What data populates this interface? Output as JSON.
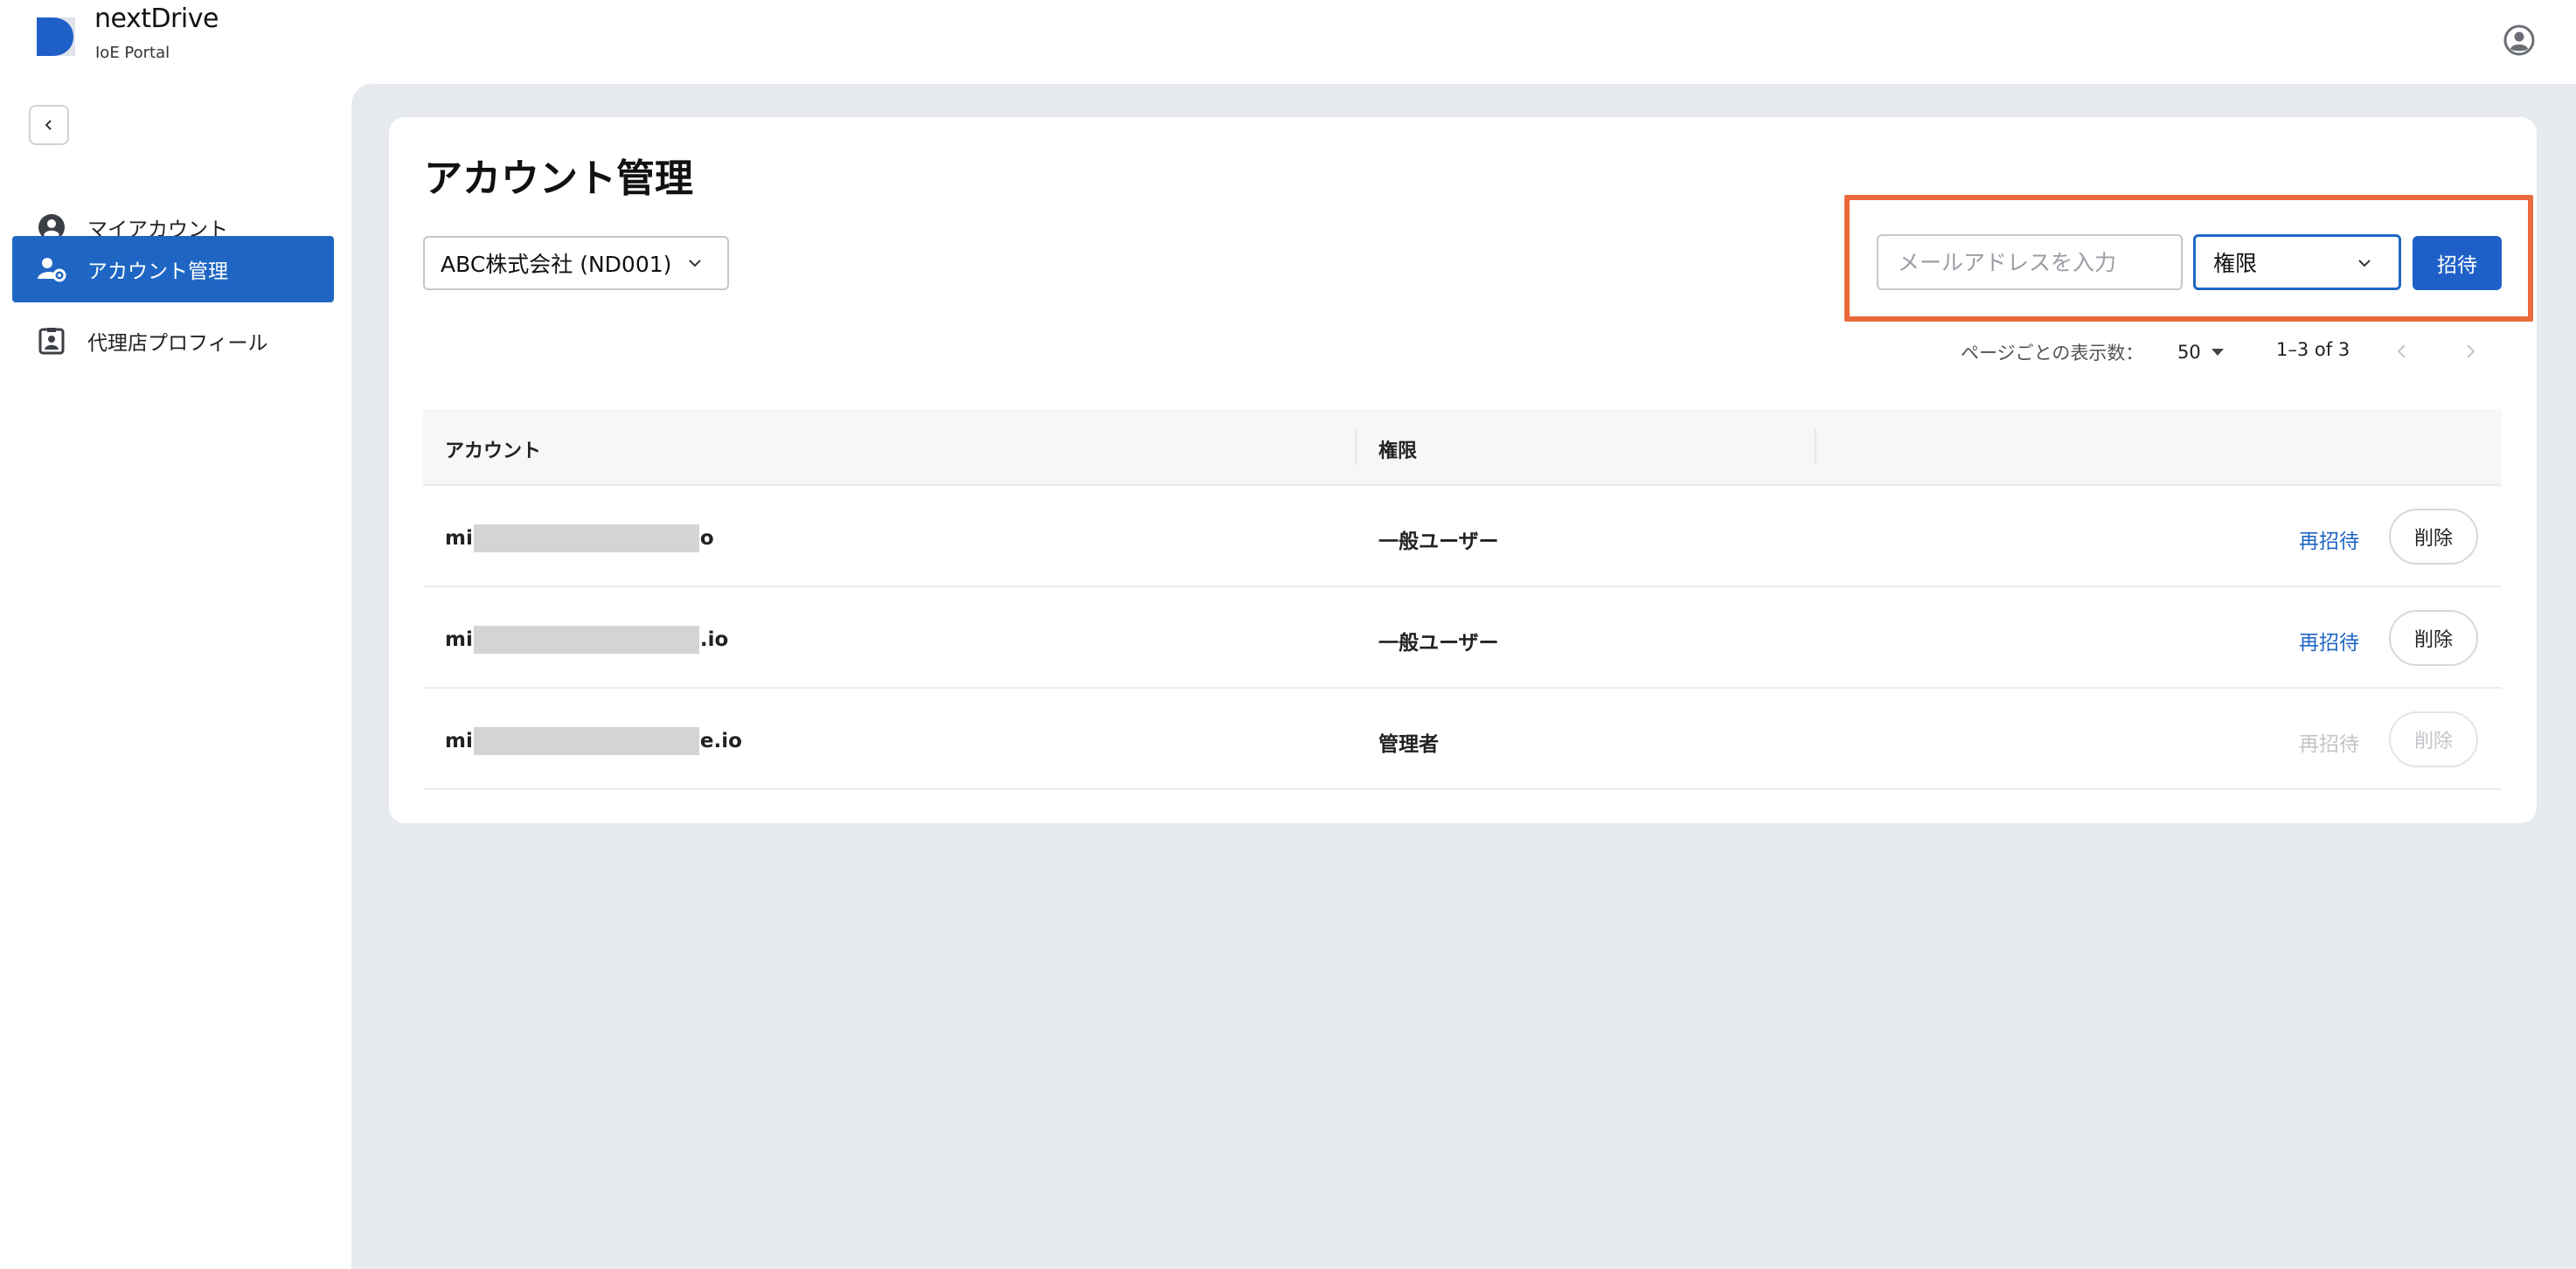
{
  "brand": {
    "name": "nextDrive",
    "subtitle": "IoE Portal",
    "logo_icon": "nextdrive-logo-icon",
    "color": "#1f5fc8"
  },
  "header": {
    "account_icon": "account-circle-icon"
  },
  "sidebar": {
    "collapse_icon": "chevron-left-icon",
    "items": [
      {
        "label": "マイアカウント",
        "icon": "account-circle-icon",
        "active": false
      },
      {
        "label": "アカウント管理",
        "icon": "user-gear-icon",
        "active": true
      },
      {
        "label": "代理店プロフィール",
        "icon": "id-badge-icon",
        "active": false
      }
    ],
    "active_color": "#1f66c4"
  },
  "main": {
    "title": "アカウント管理",
    "company_select": {
      "value": "ABC株式会社 (ND001)"
    },
    "invite": {
      "email_placeholder": "メールアドレスを入力",
      "role_value": "権限",
      "button_label": "招待",
      "highlight_color": "#ea6a3c"
    },
    "pagination": {
      "label": "ページごとの表示数：",
      "page_size": "50",
      "range": "1–3 of 3"
    },
    "table": {
      "headers": {
        "account": "アカウント",
        "role": "権限"
      },
      "rows": [
        {
          "account_prefix": "mi",
          "account_suffix": "o",
          "role": "一般ユーザー",
          "reinvite": "再招待",
          "delete": "削除",
          "enabled": true
        },
        {
          "account_prefix": "mi",
          "account_suffix": ".io",
          "role": "一般ユーザー",
          "reinvite": "再招待",
          "delete": "削除",
          "enabled": true
        },
        {
          "account_prefix": "mi",
          "account_suffix": "e.io",
          "role": "管理者",
          "reinvite": "再招待",
          "delete": "削除",
          "enabled": false
        }
      ]
    }
  }
}
